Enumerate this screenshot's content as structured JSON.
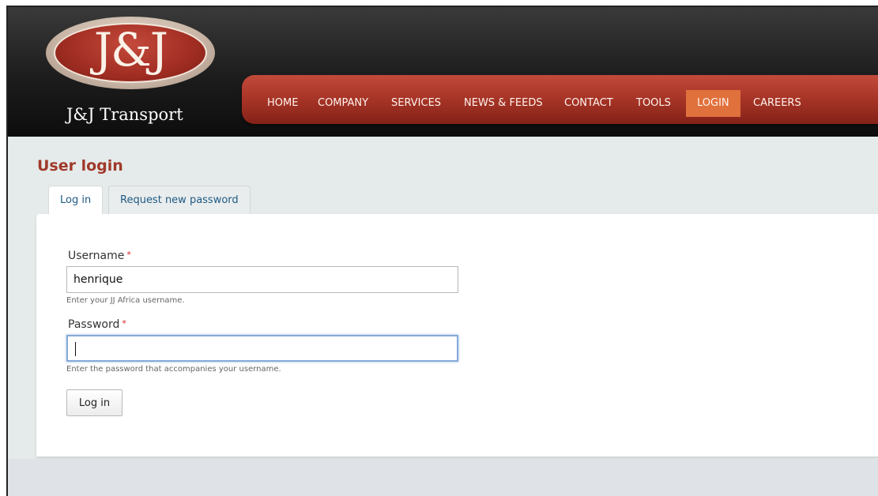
{
  "brand": {
    "logo_mark": "J&J",
    "name": "J&J Transport"
  },
  "nav": {
    "items": [
      {
        "label": "HOME",
        "active": false
      },
      {
        "label": "COMPANY",
        "active": false
      },
      {
        "label": "SERVICES",
        "active": false
      },
      {
        "label": "NEWS & FEEDS",
        "active": false
      },
      {
        "label": "CONTACT",
        "active": false
      },
      {
        "label": "TOOLS",
        "active": false
      },
      {
        "label": "LOGIN",
        "active": true
      },
      {
        "label": "CAREERS",
        "active": false
      }
    ]
  },
  "page": {
    "title": "User login"
  },
  "tabs": [
    {
      "label": "Log in",
      "active": true
    },
    {
      "label": "Request new password",
      "active": false
    }
  ],
  "form": {
    "username": {
      "label": "Username",
      "required_mark": "*",
      "value": "henrique",
      "help": "Enter your JJ Africa username."
    },
    "password": {
      "label": "Password",
      "required_mark": "*",
      "value": "",
      "help": "Enter the password that accompanies your username."
    },
    "submit_label": "Log in"
  },
  "colors": {
    "brand_red": "#a63426",
    "active_nav": "#e0703c",
    "title_red": "#a0392b",
    "link_blue": "#1e5a84"
  }
}
